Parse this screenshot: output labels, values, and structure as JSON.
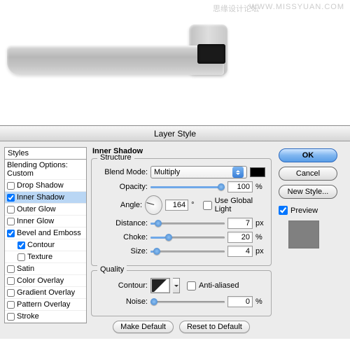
{
  "watermark": {
    "cn": "思缘设计论坛",
    "en": "WWW.MISSYUAN.COM"
  },
  "dialog": {
    "title": "Layer Style"
  },
  "styles": {
    "header": "Styles",
    "blending": "Blending Options: Custom",
    "items": [
      {
        "label": "Drop Shadow",
        "checked": false
      },
      {
        "label": "Inner Shadow",
        "checked": true,
        "selected": true
      },
      {
        "label": "Outer Glow",
        "checked": false
      },
      {
        "label": "Inner Glow",
        "checked": false
      },
      {
        "label": "Bevel and Emboss",
        "checked": true
      },
      {
        "label": "Contour",
        "checked": true,
        "indent": true
      },
      {
        "label": "Texture",
        "checked": false,
        "indent": true
      },
      {
        "label": "Satin",
        "checked": false
      },
      {
        "label": "Color Overlay",
        "checked": false
      },
      {
        "label": "Gradient Overlay",
        "checked": false
      },
      {
        "label": "Pattern Overlay",
        "checked": false
      },
      {
        "label": "Stroke",
        "checked": false
      }
    ]
  },
  "panel": {
    "title": "Inner Shadow",
    "structure": {
      "legend": "Structure",
      "blendmode_label": "Blend Mode:",
      "blendmode_value": "Multiply",
      "swatch_color": "#000000",
      "opacity_label": "Opacity:",
      "opacity_value": "100",
      "opacity_unit": "%",
      "angle_label": "Angle:",
      "angle_value": "164",
      "angle_unit": "°",
      "global_label": "Use Global Light",
      "distance_label": "Distance:",
      "distance_value": "7",
      "distance_unit": "px",
      "choke_label": "Choke:",
      "choke_value": "20",
      "choke_unit": "%",
      "size_label": "Size:",
      "size_value": "4",
      "size_unit": "px"
    },
    "quality": {
      "legend": "Quality",
      "contour_label": "Contour:",
      "antialias_label": "Anti-aliased",
      "noise_label": "Noise:",
      "noise_value": "0",
      "noise_unit": "%"
    },
    "make_default": "Make Default",
    "reset_default": "Reset to Default"
  },
  "buttons": {
    "ok": "OK",
    "cancel": "Cancel",
    "newstyle": "New Style...",
    "preview": "Preview"
  },
  "chart_data": {
    "type": "table",
    "title": "Inner Shadow settings",
    "rows": [
      {
        "param": "Blend Mode",
        "value": "Multiply"
      },
      {
        "param": "Opacity",
        "value": 100,
        "unit": "%"
      },
      {
        "param": "Angle",
        "value": 164,
        "unit": "deg",
        "use_global_light": false
      },
      {
        "param": "Distance",
        "value": 7,
        "unit": "px"
      },
      {
        "param": "Choke",
        "value": 20,
        "unit": "%"
      },
      {
        "param": "Size",
        "value": 4,
        "unit": "px"
      },
      {
        "param": "Anti-aliased",
        "value": false
      },
      {
        "param": "Noise",
        "value": 0,
        "unit": "%"
      }
    ]
  }
}
